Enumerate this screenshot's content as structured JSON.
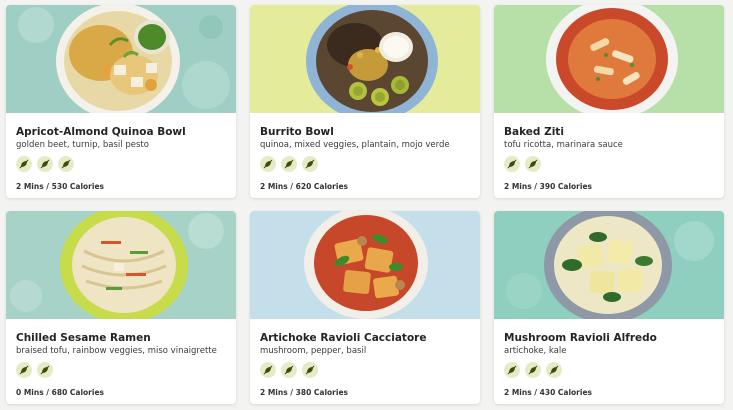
{
  "colors": {
    "card_bg": "#ffffff",
    "page_bg": "#f3f3f1",
    "badge_bg": "#e5ebc6",
    "badge_icon": "#3f4b0d"
  },
  "meals": [
    {
      "title": "Apricot-Almond Quinoa Bowl",
      "subtitle": "golden beet, turnip, basil pesto",
      "meta": "2 Mins / 530 Calories",
      "badges": [
        "leaf-badge-icon",
        "leaf-badge-icon",
        "leaf-badge-icon"
      ],
      "photo_bg": "#9fcfc4"
    },
    {
      "title": "Burrito Bowl",
      "subtitle": "quinoa, mixed veggies, plantain, mojo verde",
      "meta": "2 Mins / 620 Calories",
      "badges": [
        "leaf-badge-icon",
        "leaf-badge-icon",
        "leaf-badge-icon"
      ],
      "photo_bg": "#e4ec9c"
    },
    {
      "title": "Baked Ziti",
      "subtitle": "tofu ricotta, marinara sauce",
      "meta": "2 Mins / 390 Calories",
      "badges": [
        "leaf-badge-icon",
        "leaf-badge-icon"
      ],
      "photo_bg": "#b7e0a9"
    },
    {
      "title": "Chilled Sesame Ramen",
      "subtitle": "braised tofu, rainbow veggies, miso vinaigrette",
      "meta": "0 Mins / 680 Calories",
      "badges": [
        "leaf-badge-icon",
        "leaf-badge-icon"
      ],
      "photo_bg": "#a6d2c7"
    },
    {
      "title": "Artichoke Ravioli Cacciatore",
      "subtitle": "mushroom, pepper, basil",
      "meta": "2 Mins / 380 Calories",
      "badges": [
        "leaf-badge-icon",
        "leaf-badge-icon",
        "leaf-badge-icon"
      ],
      "photo_bg": "#c4dfe9"
    },
    {
      "title": "Mushroom Ravioli Alfredo",
      "subtitle": "artichoke, kale",
      "meta": "2 Mins / 430 Calories",
      "badges": [
        "leaf-badge-icon",
        "leaf-badge-icon",
        "leaf-badge-icon"
      ],
      "photo_bg": "#8fcfbf"
    }
  ]
}
